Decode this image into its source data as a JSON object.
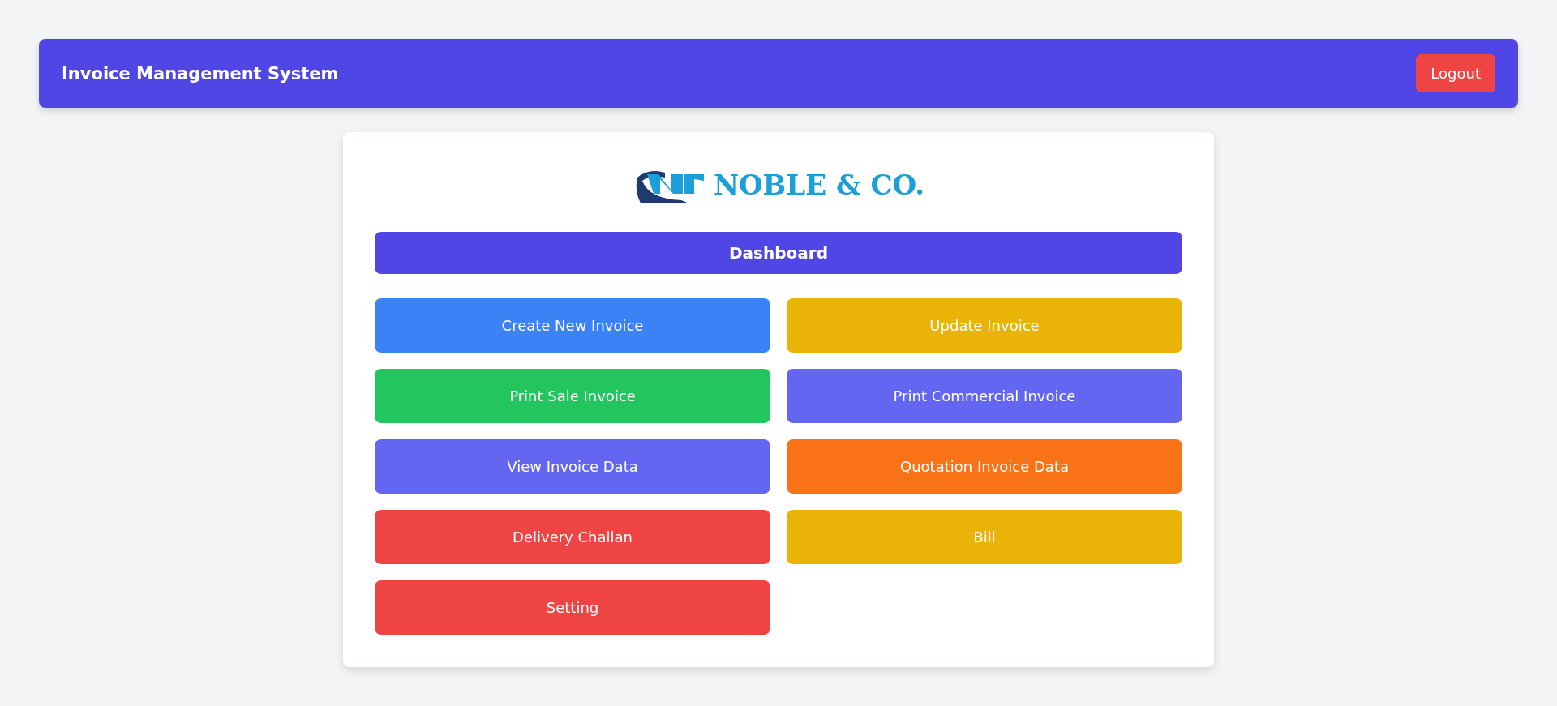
{
  "header": {
    "title": "Invoice Management System",
    "logout": "Logout"
  },
  "logo": {
    "name": "NOBLE & CO."
  },
  "dashboard": {
    "title": "Dashboard"
  },
  "actions": [
    {
      "label": "Create New Invoice",
      "color": "#3b82f6"
    },
    {
      "label": "Update Invoice",
      "color": "#eab308"
    },
    {
      "label": "Print Sale Invoice",
      "color": "#22c55e"
    },
    {
      "label": "Print Commercial Invoice",
      "color": "#6366f1"
    },
    {
      "label": "View Invoice Data",
      "color": "#6366f1"
    },
    {
      "label": "Quotation Invoice Data",
      "color": "#f97316"
    },
    {
      "label": "Delivery Challan",
      "color": "#ef4444"
    },
    {
      "label": "Bill",
      "color": "#eab308"
    },
    {
      "label": "Setting",
      "color": "#ef4444"
    }
  ]
}
